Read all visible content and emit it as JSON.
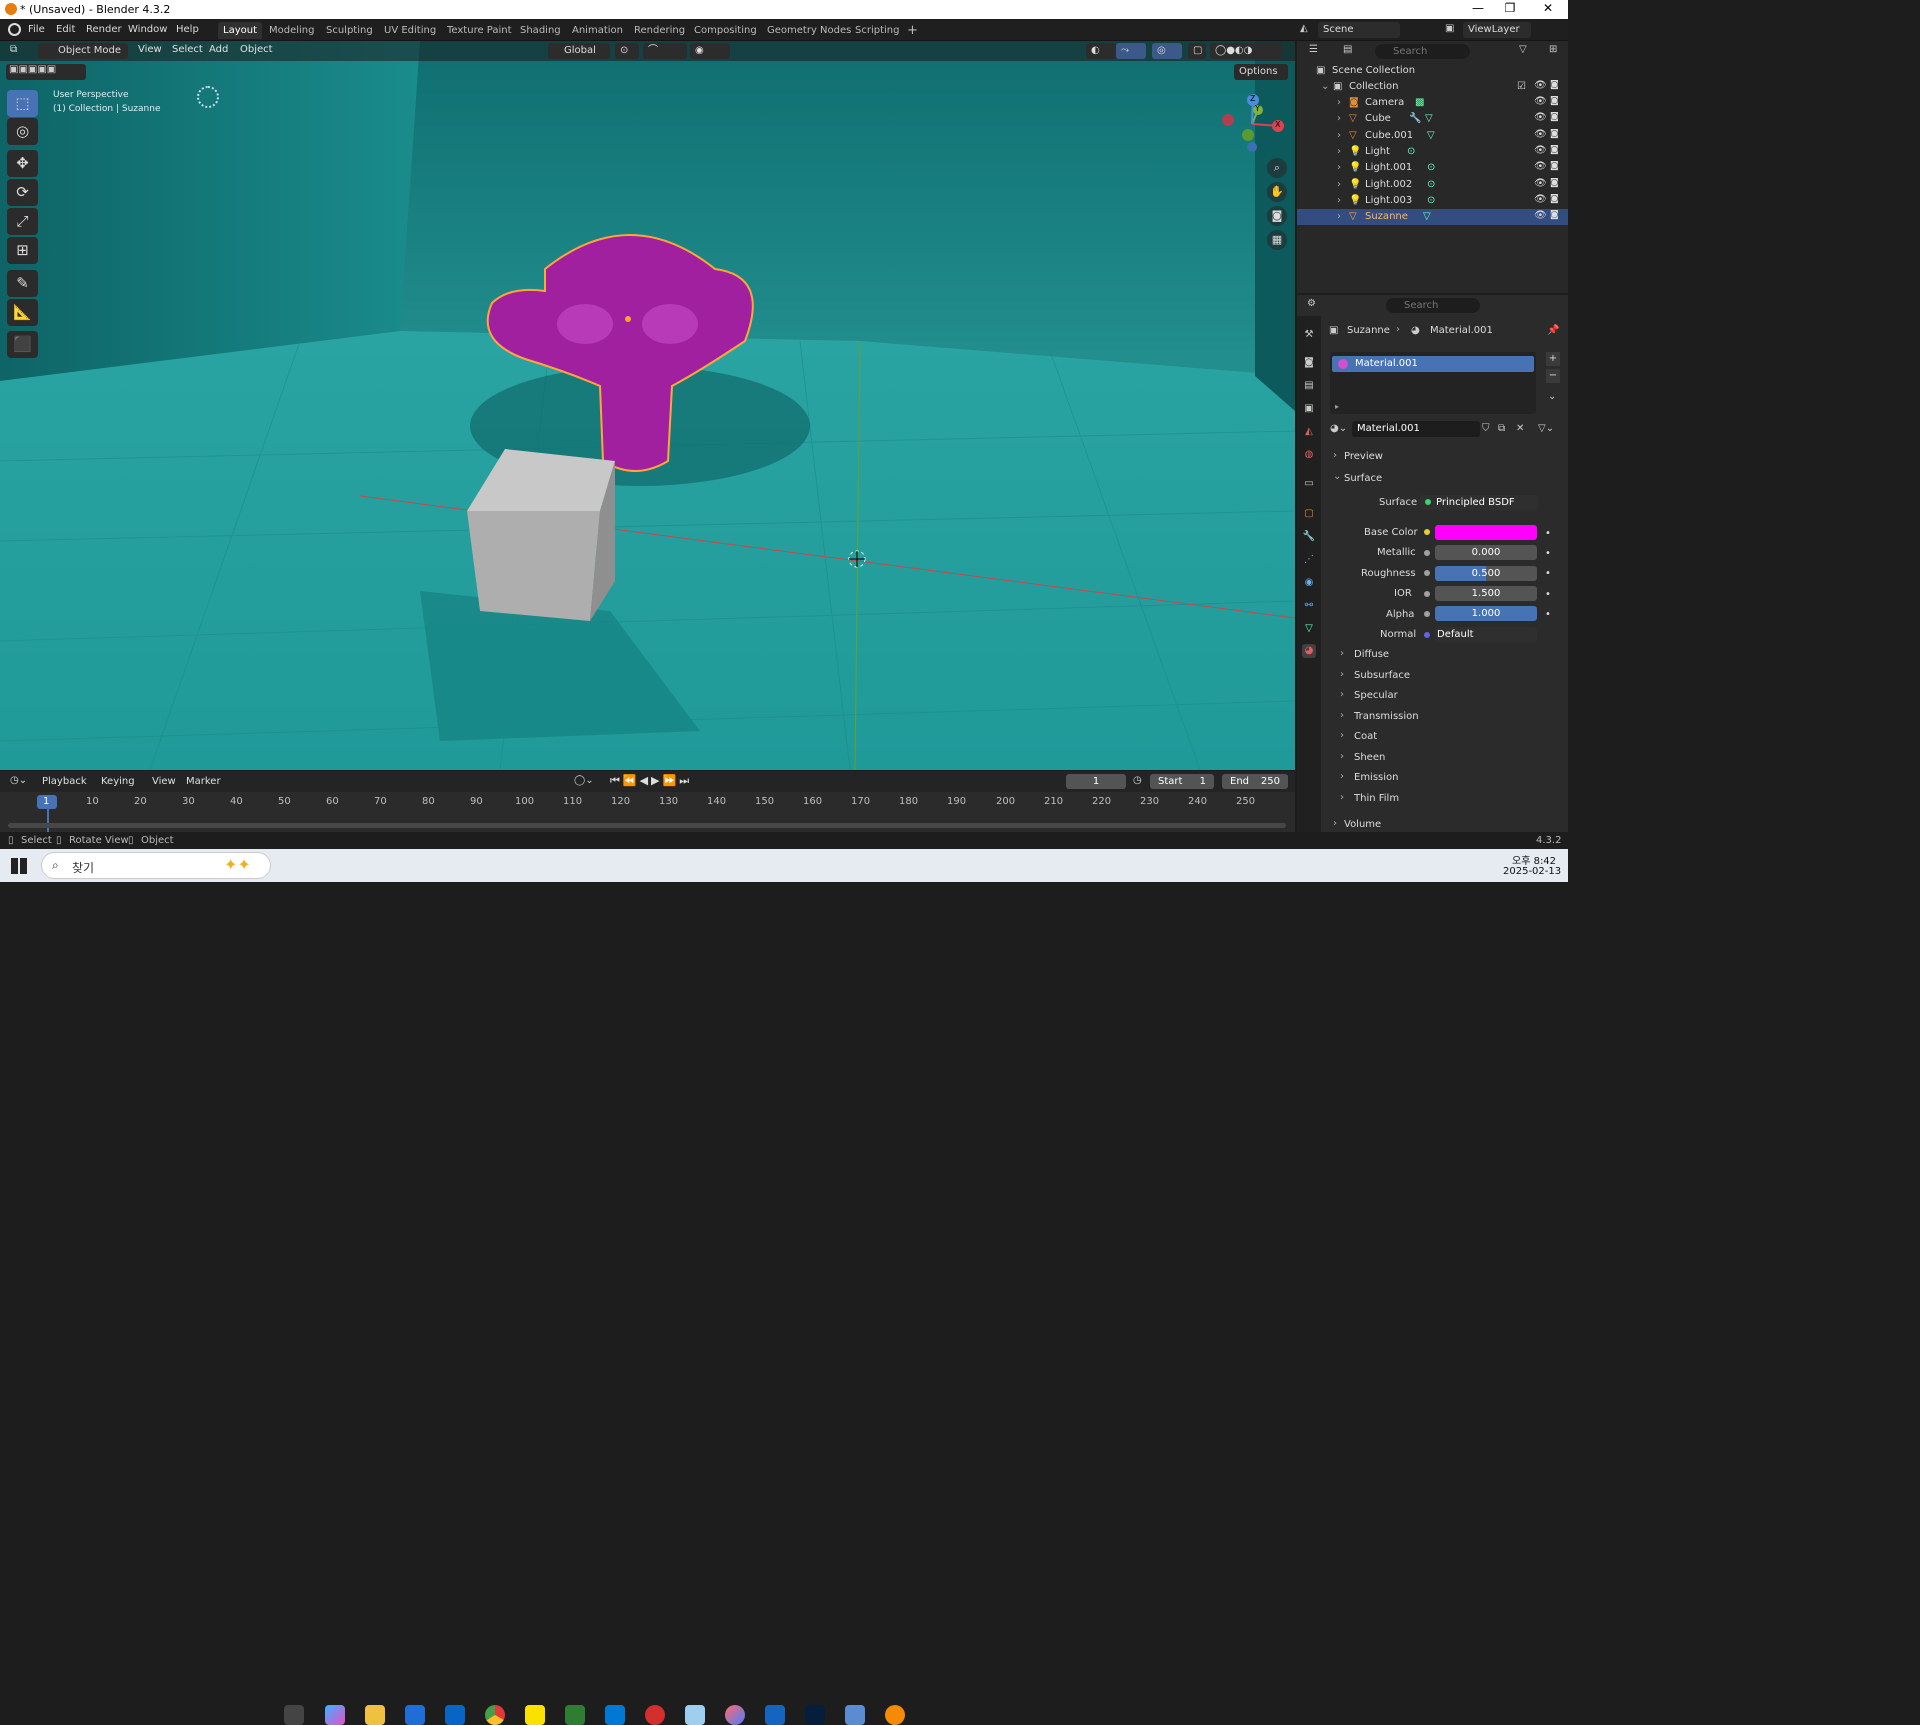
{
  "window": {
    "title": "* (Unsaved) - Blender 4.3.2",
    "min": "—",
    "max": "❐",
    "close": "✕"
  },
  "menus": [
    "File",
    "Edit",
    "Render",
    "Window",
    "Help"
  ],
  "workspaces": [
    "Layout",
    "Modeling",
    "Sculpting",
    "UV Editing",
    "Texture Paint",
    "Shading",
    "Animation",
    "Rendering",
    "Compositing",
    "Geometry Nodes",
    "Scripting"
  ],
  "add_workspace": "+",
  "scene": {
    "name": "Scene",
    "view_layer": "ViewLayer"
  },
  "viewport": {
    "mode": "Object Mode",
    "menus": [
      "View",
      "Select",
      "Add",
      "Object"
    ],
    "orientation": "Global",
    "options": "Options",
    "overlay_text": [
      "User Perspective",
      "(1) Collection | Suzanne"
    ],
    "gizmo": {
      "x": "X",
      "y": "Y",
      "z": "Z"
    }
  },
  "outliner": {
    "search_placeholder": "Search",
    "items": [
      {
        "label": "Scene Collection"
      },
      {
        "label": "Collection"
      },
      {
        "label": "Camera",
        "icon": "camera-icon"
      },
      {
        "label": "Cube",
        "icon": "mesh-icon"
      },
      {
        "label": "Cube.001",
        "icon": "mesh-icon"
      },
      {
        "label": "Light",
        "icon": "light-icon"
      },
      {
        "label": "Light.001",
        "icon": "light-icon"
      },
      {
        "label": "Light.002",
        "icon": "light-icon"
      },
      {
        "label": "Light.003",
        "icon": "light-icon"
      },
      {
        "label": "Suzanne",
        "icon": "mesh-icon",
        "selected": true
      }
    ]
  },
  "properties": {
    "search_placeholder": "Search",
    "breadcrumb": [
      "Suzanne",
      "Material.001"
    ],
    "material_slot": "Material.001",
    "material_name": "Material.001",
    "panels": {
      "preview": "Preview",
      "surface": "Surface"
    },
    "surface": {
      "label": "Surface",
      "value": "Principled BSDF"
    },
    "fields": [
      {
        "label": "Base Color",
        "value": "",
        "color": "#ff00ff"
      },
      {
        "label": "Metallic",
        "value": "0.000",
        "fill": 0
      },
      {
        "label": "Roughness",
        "value": "0.500",
        "fill": 0.5
      },
      {
        "label": "IOR",
        "value": "1.500",
        "fill": 0
      },
      {
        "label": "Alpha",
        "value": "1.000",
        "fill": 1
      }
    ],
    "normal": {
      "label": "Normal",
      "value": "Default"
    },
    "subpanels": [
      "Diffuse",
      "Subsurface",
      "Specular",
      "Transmission",
      "Coat",
      "Sheen",
      "Emission",
      "Thin Film"
    ],
    "volume": "Volume"
  },
  "timeline": {
    "menus": [
      "Playback",
      "Keying",
      "View",
      "Marker"
    ],
    "current_frame": "1",
    "start_label": "Start",
    "start": "1",
    "end_label": "End",
    "end": "250",
    "ticks": [
      "1",
      "10",
      "20",
      "30",
      "40",
      "50",
      "60",
      "70",
      "80",
      "90",
      "100",
      "110",
      "120",
      "130",
      "140",
      "150",
      "160",
      "170",
      "180",
      "190",
      "200",
      "210",
      "220",
      "230",
      "240",
      "250"
    ]
  },
  "statusbar": {
    "items": [
      "Select",
      "Rotate View",
      "Object"
    ],
    "version": "4.3.2"
  },
  "taskbar": {
    "search": "찾기",
    "time": "오후 8:42",
    "date": "2025-02-13"
  },
  "colors": {
    "viewport_bg": "#137678",
    "accent": "#4772b3",
    "selection": "#ffa53a",
    "suzanne": "#a020a0"
  }
}
